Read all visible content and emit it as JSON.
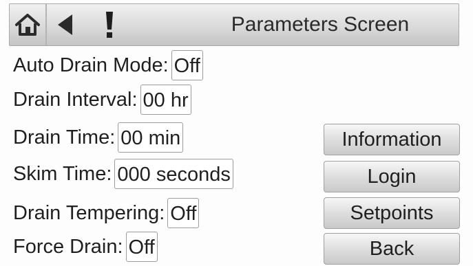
{
  "header": {
    "title": "Parameters Screen",
    "icons": [
      "home-icon",
      "back-arrow-icon",
      "alert-icon"
    ]
  },
  "params": [
    {
      "label": "Auto Drain Mode:",
      "value": "Off"
    },
    {
      "label": "Drain Interval:",
      "value": "00 hr"
    },
    {
      "label": "Drain Time:",
      "value": "00 min"
    },
    {
      "label": "Skim Time:",
      "value": "000 seconds"
    },
    {
      "label": "Drain Tempering:",
      "value": "Off"
    },
    {
      "label": "Force Drain:",
      "value": "Off"
    }
  ],
  "nav": {
    "information": "Information",
    "login": "Login",
    "setpoints": "Setpoints",
    "back": "Back"
  },
  "colors": {
    "background": "#fdfdfd",
    "header_gradient_top": "#f1f1f1",
    "header_gradient_bottom": "#c4c4c4",
    "icon": "#2b2b2b"
  }
}
